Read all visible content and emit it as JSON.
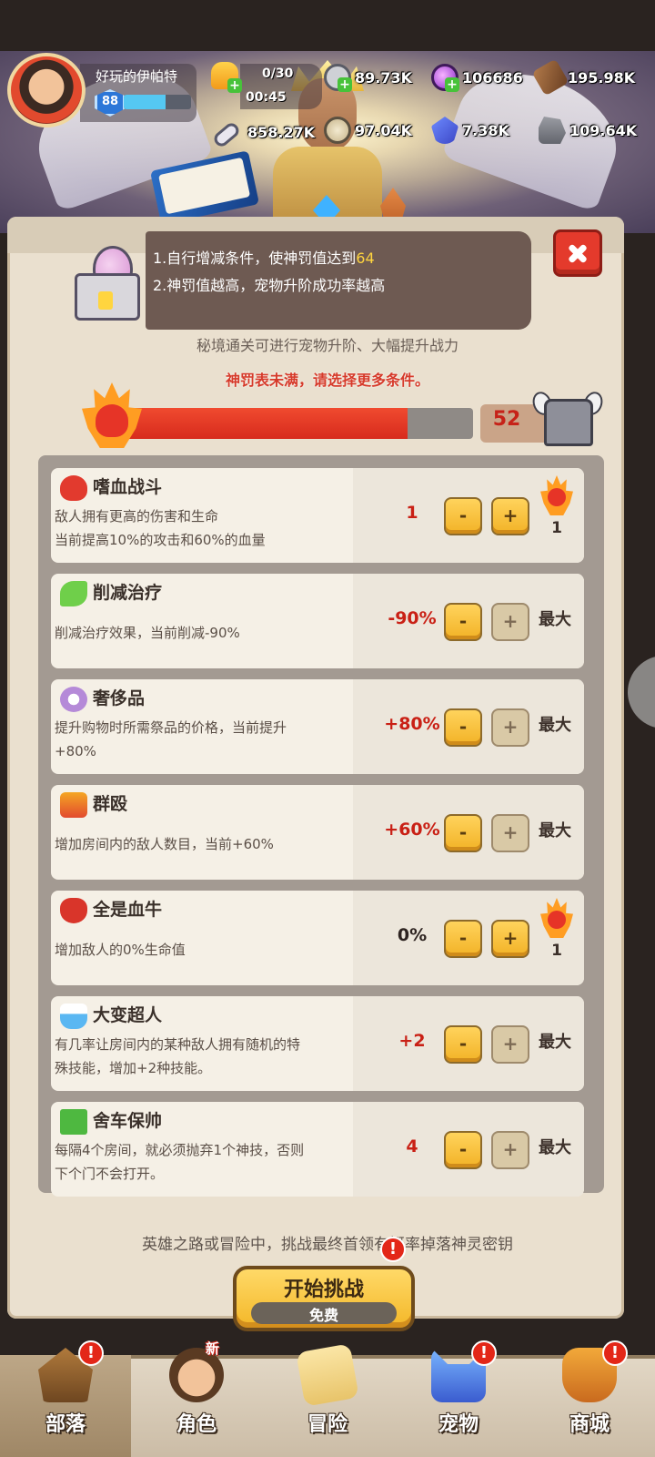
{
  "player": {
    "name": "好玩的伊帕特",
    "level": "88",
    "exp_fraction": 0.62
  },
  "energy": {
    "count": "0/30",
    "timer": "00:45"
  },
  "resources": [
    {
      "icon": "ore-icon",
      "value": "89.73K"
    },
    {
      "icon": "purple-gem-icon",
      "value": "106686"
    },
    {
      "icon": "wood-icon",
      "value": "195.98K"
    },
    {
      "icon": "bone-icon",
      "value": "858.27K"
    },
    {
      "icon": "seal-coin-icon",
      "value": "97.04K"
    },
    {
      "icon": "blue-crystal-icon",
      "value": "7.38K"
    },
    {
      "icon": "stone-icon",
      "value": "109.64K"
    }
  ],
  "rules": {
    "line1_prefix": "1.自行增减条件，使神罚值达到",
    "line1_target": "64",
    "line2": "2.神罚值越高，宠物升阶成功率越高"
  },
  "hint_sub": "秘境通关可进行宠物升阶、大幅提升战力",
  "hint_warning": "神罚表未满，请选择更多条件。",
  "progress": {
    "current": "52",
    "target": 64,
    "fill_fraction": 0.8125
  },
  "conditions": [
    {
      "title": "嗜血战斗",
      "desc": [
        "敌人拥有更高的伤害和生命",
        "当前提高10%的攻击和60%的血量"
      ],
      "value": "1",
      "minus_enabled": true,
      "plus_enabled": true,
      "cost": "1",
      "max": ""
    },
    {
      "title": "削减治疗",
      "desc": [
        "削减治疗效果，当前削减-90%"
      ],
      "value": "-90%",
      "minus_enabled": true,
      "plus_enabled": false,
      "cost": "",
      "max": "最大"
    },
    {
      "title": "奢侈品",
      "desc": [
        "提升购物时所需祭品的价格，当前提升",
        "+80%"
      ],
      "value": "+80%",
      "minus_enabled": true,
      "plus_enabled": false,
      "cost": "",
      "max": "最大"
    },
    {
      "title": "群殴",
      "desc": [
        "增加房间内的敌人数目，当前+60%"
      ],
      "value": "+60%",
      "minus_enabled": true,
      "plus_enabled": false,
      "cost": "",
      "max": "最大"
    },
    {
      "title": "全是血牛",
      "desc": [
        "增加敌人的0%生命值"
      ],
      "value": "0%",
      "minus_enabled": true,
      "plus_enabled": true,
      "cost": "1",
      "max": ""
    },
    {
      "title": "大变超人",
      "desc": [
        "有几率让房间内的某种敌人拥有随机的特",
        "殊技能，增加+2种技能。"
      ],
      "value": "+2",
      "minus_enabled": true,
      "plus_enabled": false,
      "cost": "",
      "max": "最大"
    },
    {
      "title": "舍车保帅",
      "desc": [
        "每隔4个房间，就必须抛弃1个神技，否则",
        "下个门不会打开。"
      ],
      "value": "4",
      "minus_enabled": true,
      "plus_enabled": false,
      "cost": "",
      "max": "最大"
    }
  ],
  "buttons": {
    "minus": "-",
    "plus": "+"
  },
  "bottom_hint": "英雄之路或冒险中，挑战最终首领有概率掉落神灵密钥",
  "start": {
    "title": "开始挑战",
    "sub": "免费",
    "alert": "!"
  },
  "nav": [
    {
      "label": "部落",
      "icon": "tribe-icon",
      "alert": "!",
      "new": ""
    },
    {
      "label": "角色",
      "icon": "character-icon",
      "alert": "",
      "new": "新"
    },
    {
      "label": "冒险",
      "icon": "map-icon",
      "alert": "",
      "new": ""
    },
    {
      "label": "宠物",
      "icon": "pet-icon",
      "alert": "!",
      "new": ""
    },
    {
      "label": "商城",
      "icon": "shop-icon",
      "alert": "!",
      "new": ""
    }
  ],
  "colors": {
    "accent_red": "#e43a2c",
    "button_yellow": "#f2b226",
    "progress_red": "#e8402a",
    "highlight_yellow": "#ffd53f"
  }
}
